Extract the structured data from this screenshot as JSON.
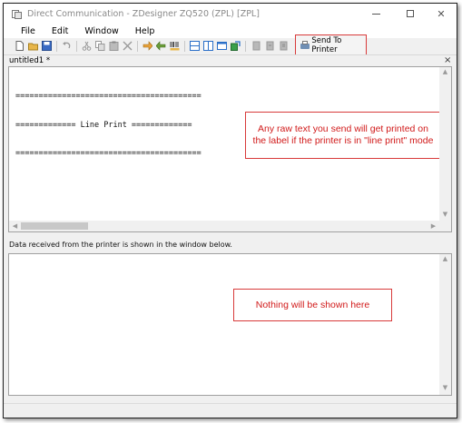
{
  "window": {
    "title": "Direct Communication - ZDesigner ZQ520 (ZPL) [ZPL]",
    "minimize": "minimize",
    "maximize": "maximize",
    "close_glyph": "✕"
  },
  "menu": {
    "items": [
      {
        "label": "File"
      },
      {
        "label": "Edit"
      },
      {
        "label": "Window"
      },
      {
        "label": "Help"
      }
    ]
  },
  "toolbar": {
    "icons": [
      "new-file-icon",
      "open-folder-icon",
      "save-icon",
      "undo-icon",
      "cut-icon",
      "copy-icon",
      "paste-icon",
      "delete-icon",
      "send-file-icon",
      "receive-icon",
      "barcode-icon",
      "split-horizontal-icon",
      "split-vertical-icon",
      "window-icon",
      "export-icon",
      "printer-gray-icon",
      "printer-gray-2-icon",
      "printer-gray-3-icon"
    ],
    "send_button_label": "Send To Printer"
  },
  "document": {
    "tab_label": "untitled1 *",
    "tab_close": "×",
    "content_lines": [
      "========================================",
      "============= Line Print =============",
      "========================================"
    ]
  },
  "annotations": {
    "editor_note": "Any raw text you send will get printed on the label if the printer is in \"line print\" mode",
    "output_note": "Nothing will be shown here"
  },
  "received": {
    "info_text": "Data received from the printer is shown in the window below."
  },
  "colors": {
    "callout_border": "#d83a3a",
    "callout_text": "#d11a1a"
  }
}
